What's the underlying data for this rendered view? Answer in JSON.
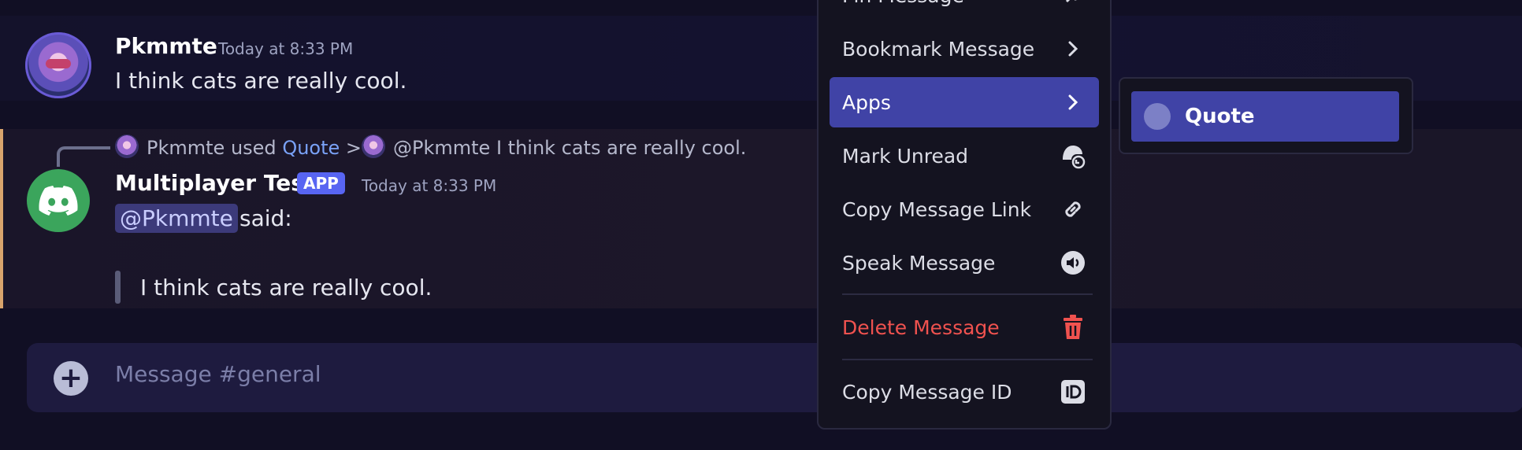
{
  "message1": {
    "author": "Pkmmte",
    "timestamp": "Today at 8:33 PM",
    "text": "I think cats are really cool."
  },
  "message2": {
    "reply": {
      "user": "Pkmmte",
      "used_text": "used",
      "command": "Quote",
      "chevron": ">",
      "mention": "@Pkmmte",
      "quoted_text": "I think cats are really cool."
    },
    "author": "Multiplayer Test",
    "badge": "APP",
    "timestamp": "Today at 8:33 PM",
    "mention": "@Pkmmte",
    "said": "said:",
    "quote": "I think cats are really cool."
  },
  "composer": {
    "placeholder": "Message #general",
    "plus_icon": "plus-circle-icon"
  },
  "context_menu": {
    "items": [
      {
        "label": "Pin Message",
        "icon": "pin-icon"
      },
      {
        "label": "Bookmark Message",
        "icon": "chevron-right-icon"
      },
      {
        "label": "Apps",
        "icon": "chevron-right-icon",
        "active": true
      },
      {
        "label": "Mark Unread",
        "icon": "mark-unread-icon"
      },
      {
        "label": "Copy Message Link",
        "icon": "link-icon"
      },
      {
        "label": "Speak Message",
        "icon": "speaker-icon"
      },
      {
        "label": "Delete Message",
        "icon": "trash-icon",
        "danger": true
      },
      {
        "label": "Copy Message ID",
        "icon": "id-icon"
      }
    ],
    "colors": {
      "active": "#4043a6",
      "danger": "#f0524f"
    }
  },
  "apps_submenu": {
    "items": [
      {
        "label": "Quote",
        "icon": "app-avatar-icon"
      }
    ]
  }
}
